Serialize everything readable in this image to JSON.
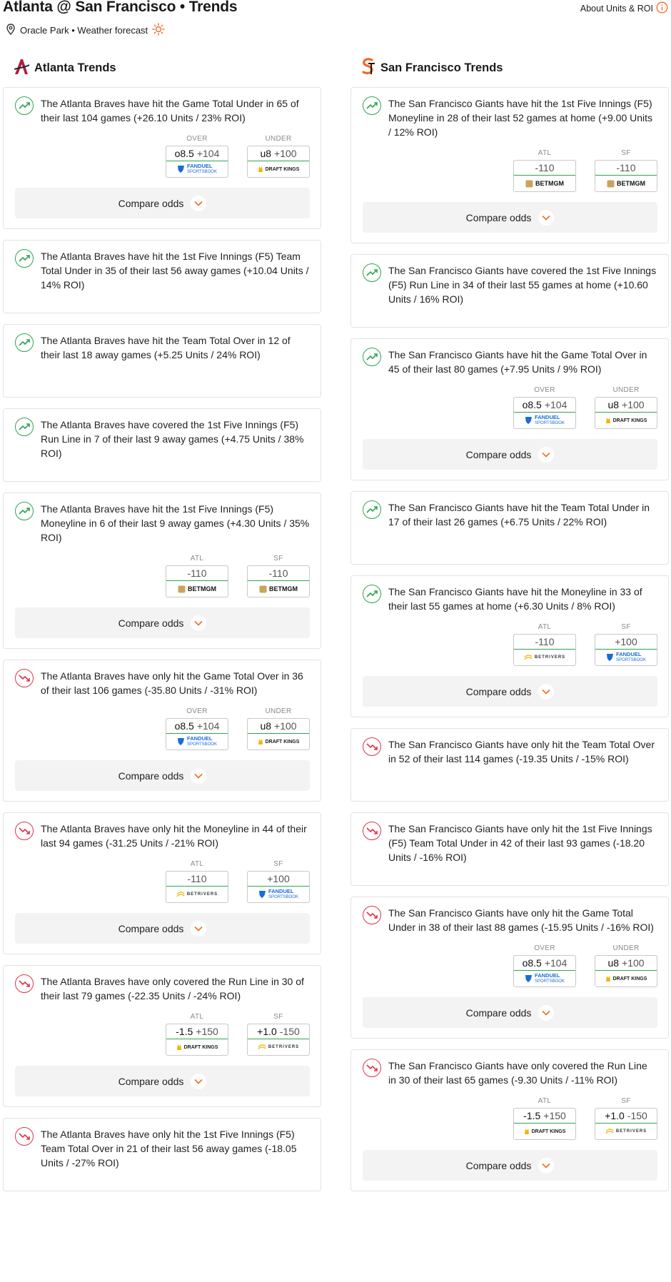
{
  "header": {
    "title": "Atlanta @ San Francisco • Trends",
    "location": "Oracle Park • Weather forecast",
    "about_link": "About Units & ROI"
  },
  "colors": {
    "positive": "#2ea551",
    "negative": "#e0354a",
    "accent": "#f26a21",
    "braves": "#b51d36",
    "giants": "#f26a21"
  },
  "columns": [
    {
      "title": "Atlanta Trends",
      "logo_icon": "braves-logo",
      "trends": [
        {
          "direction": "up",
          "text": "The Atlanta Braves have hit the Game Total Under in 65 of their last 104 games (+26.10 Units / 23% ROI)",
          "odds": [
            {
              "label": "OVER",
              "line": "o8.5",
              "price": "+104",
              "book": "FANDUEL",
              "book_sub": "SPORTSBOOK"
            },
            {
              "label": "UNDER",
              "line": "u8",
              "price": "+100",
              "book": "DRAFT KINGS",
              "book_sub": ""
            }
          ],
          "compare_label": "Compare odds"
        },
        {
          "direction": "up",
          "text": "The Atlanta Braves have hit the 1st Five Innings (F5) Team Total Under in 35 of their last 56 away games (+10.04 Units / 14% ROI)",
          "odds": []
        },
        {
          "direction": "up",
          "text": "The Atlanta Braves have hit the Team Total Over in 12 of their last 18 away games (+5.25 Units / 24% ROI)",
          "odds": []
        },
        {
          "direction": "up",
          "text": "The Atlanta Braves have covered the 1st Five Innings (F5) Run Line in 7 of their last 9 away games (+4.75 Units / 38% ROI)",
          "odds": []
        },
        {
          "direction": "up",
          "text": "The Atlanta Braves have hit the 1st Five Innings (F5) Moneyline in 6 of their last 9 away games (+4.30 Units / 35% ROI)",
          "odds": [
            {
              "label": "ATL",
              "line": "",
              "price": "-110",
              "book": "BETMGM",
              "book_sub": ""
            },
            {
              "label": "SF",
              "line": "",
              "price": "-110",
              "book": "BETMGM",
              "book_sub": ""
            }
          ],
          "compare_label": "Compare odds"
        },
        {
          "direction": "down",
          "text": "The Atlanta Braves have only hit the Game Total Over in 36 of their last 106 games (-35.80 Units / -31% ROI)",
          "odds": [
            {
              "label": "OVER",
              "line": "o8.5",
              "price": "+104",
              "book": "FANDUEL",
              "book_sub": "SPORTSBOOK"
            },
            {
              "label": "UNDER",
              "line": "u8",
              "price": "+100",
              "book": "DRAFT KINGS",
              "book_sub": ""
            }
          ],
          "compare_label": "Compare odds"
        },
        {
          "direction": "down",
          "text": "The Atlanta Braves have only hit the Moneyline in 44 of their last 94 games (-31.25 Units / -21% ROI)",
          "odds": [
            {
              "label": "ATL",
              "line": "",
              "price": "-110",
              "book": "BETRIVERS",
              "book_sub": ""
            },
            {
              "label": "SF",
              "line": "",
              "price": "+100",
              "book": "FANDUEL",
              "book_sub": "SPORTSBOOK"
            }
          ],
          "compare_label": "Compare odds"
        },
        {
          "direction": "down",
          "text": "The Atlanta Braves have only covered the Run Line in 30 of their last 79 games (-22.35 Units / -24% ROI)",
          "odds": [
            {
              "label": "ATL",
              "line": "-1.5",
              "price": "+150",
              "book": "DRAFT KINGS",
              "book_sub": ""
            },
            {
              "label": "SF",
              "line": "+1.0",
              "price": "-150",
              "book": "BETRIVERS",
              "book_sub": ""
            }
          ],
          "compare_label": "Compare odds"
        },
        {
          "direction": "down",
          "text": "The Atlanta Braves have only hit the 1st Five Innings (F5) Team Total Over in 21 of their last 56 away games (-18.05 Units / -27% ROI)",
          "odds": []
        }
      ]
    },
    {
      "title": "San Francisco Trends",
      "logo_icon": "giants-logo",
      "trends": [
        {
          "direction": "up",
          "text": "The San Francisco Giants have hit the 1st Five Innings (F5) Moneyline in 28 of their last 52 games at home (+9.00 Units / 12% ROI)",
          "odds": [
            {
              "label": "ATL",
              "line": "",
              "price": "-110",
              "book": "BETMGM",
              "book_sub": ""
            },
            {
              "label": "SF",
              "line": "",
              "price": "-110",
              "book": "BETMGM",
              "book_sub": ""
            }
          ],
          "compare_label": "Compare odds"
        },
        {
          "direction": "up",
          "text": "The San Francisco Giants have covered the 1st Five Innings (F5) Run Line in 34 of their last 55 games at home (+10.60 Units / 16% ROI)",
          "odds": []
        },
        {
          "direction": "up",
          "text": "The San Francisco Giants have hit the Game Total Over in 45 of their last 80 games (+7.95 Units / 9% ROI)",
          "odds": [
            {
              "label": "OVER",
              "line": "o8.5",
              "price": "+104",
              "book": "FANDUEL",
              "book_sub": "SPORTSBOOK"
            },
            {
              "label": "UNDER",
              "line": "u8",
              "price": "+100",
              "book": "DRAFT KINGS",
              "book_sub": ""
            }
          ],
          "compare_label": "Compare odds"
        },
        {
          "direction": "up",
          "text": "The San Francisco Giants have hit the Team Total Under in 17 of their last 26 games (+6.75 Units / 22% ROI)",
          "odds": []
        },
        {
          "direction": "up",
          "text": "The San Francisco Giants have hit the Moneyline in 33 of their last 55 games at home (+6.30 Units / 8% ROI)",
          "odds": [
            {
              "label": "ATL",
              "line": "",
              "price": "-110",
              "book": "BETRIVERS",
              "book_sub": ""
            },
            {
              "label": "SF",
              "line": "",
              "price": "+100",
              "book": "FANDUEL",
              "book_sub": "SPORTSBOOK"
            }
          ],
          "compare_label": "Compare odds"
        },
        {
          "direction": "down",
          "text": "The San Francisco Giants have only hit the Team Total Over in 52 of their last 114 games (-19.35 Units / -15% ROI)",
          "odds": []
        },
        {
          "direction": "down",
          "text": "The San Francisco Giants have only hit the 1st Five Innings (F5) Team Total Under in 42 of their last 93 games (-18.20 Units / -16% ROI)",
          "odds": []
        },
        {
          "direction": "down",
          "text": "The San Francisco Giants have only hit the Game Total Under in 38 of their last 88 games (-15.95 Units / -16% ROI)",
          "odds": [
            {
              "label": "OVER",
              "line": "o8.5",
              "price": "+104",
              "book": "FANDUEL",
              "book_sub": "SPORTSBOOK"
            },
            {
              "label": "UNDER",
              "line": "u8",
              "price": "+100",
              "book": "DRAFT KINGS",
              "book_sub": ""
            }
          ],
          "compare_label": "Compare odds"
        },
        {
          "direction": "down",
          "text": "The San Francisco Giants have only covered the Run Line in 30 of their last 65 games (-9.30 Units / -11% ROI)",
          "odds": [
            {
              "label": "ATL",
              "line": "-1.5",
              "price": "+150",
              "book": "DRAFT KINGS",
              "book_sub": ""
            },
            {
              "label": "SF",
              "line": "+1.0",
              "price": "-150",
              "book": "BETRIVERS",
              "book_sub": ""
            }
          ],
          "compare_label": "Compare odds"
        }
      ]
    }
  ]
}
